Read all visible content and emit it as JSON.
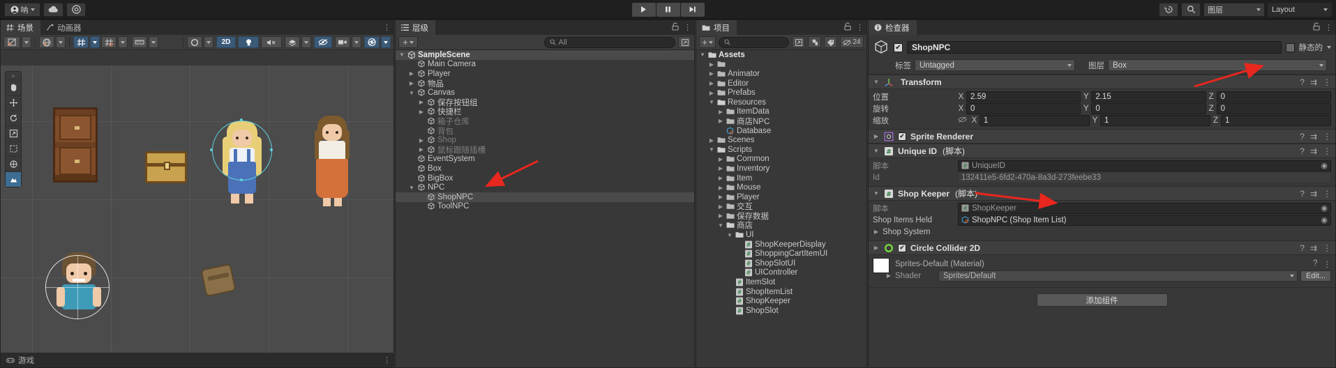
{
  "toolbar": {
    "account_label": "呐",
    "cloud_icon": "cloud-icon",
    "services_icon": "unity-services-icon",
    "play_icon": "play-icon",
    "pause_icon": "pause-icon",
    "step_icon": "step-icon",
    "undo_history_icon": "undo-history-icon",
    "search_icon": "search-icon",
    "layers_label": "图层",
    "layout_label": "Layout"
  },
  "scene": {
    "tabs": [
      {
        "label": "场景",
        "icon": "scene-grid-icon",
        "active": true
      },
      {
        "label": "动画器",
        "icon": "animator-icon",
        "active": false
      }
    ],
    "game_tab_label": "游戏",
    "toolbar": {
      "draw_mode_label": "shaded-draw-mode",
      "twod_label": "2D",
      "lighting_icon": "lighting-icon",
      "audio_icon": "audio-mute-icon",
      "fx_icon": "effects-icon",
      "hidden_icon": "hidden-objects-icon",
      "camera_icon": "scene-camera-icon",
      "gizmos_icon": "gizmos-icon"
    },
    "tools": [
      {
        "name": "hand-tool",
        "glyph": "✋",
        "selected": false
      },
      {
        "name": "move-tool",
        "glyph": "✥",
        "selected": false
      },
      {
        "name": "rotate-tool",
        "glyph": "⟳",
        "selected": false
      },
      {
        "name": "scale-tool",
        "glyph": "⤢",
        "selected": false
      },
      {
        "name": "rect-tool",
        "glyph": "⬚",
        "selected": false
      },
      {
        "name": "transform-tool",
        "glyph": "✧",
        "selected": false
      },
      {
        "name": "custom-tool",
        "glyph": "⌁",
        "selected": true
      }
    ]
  },
  "hierarchy": {
    "tab_label": "层级",
    "create_label": "+",
    "search_placeholder": "All",
    "items": [
      {
        "label": "SampleScene",
        "depth": 0,
        "arrow": "down",
        "icon": "unity-scene-icon",
        "root": true
      },
      {
        "label": "Main Camera",
        "depth": 1,
        "arrow": "none",
        "icon": "gameobject-icon"
      },
      {
        "label": "Player",
        "depth": 1,
        "arrow": "right",
        "icon": "gameobject-icon"
      },
      {
        "label": "物品",
        "depth": 1,
        "arrow": "right",
        "icon": "gameobject-icon"
      },
      {
        "label": "Canvas",
        "depth": 1,
        "arrow": "down",
        "icon": "gameobject-icon"
      },
      {
        "label": "保存按钮组",
        "depth": 2,
        "arrow": "right",
        "icon": "gameobject-icon"
      },
      {
        "label": "快捷栏",
        "depth": 2,
        "arrow": "right",
        "icon": "gameobject-icon"
      },
      {
        "label": "箱子仓库",
        "depth": 2,
        "arrow": "none",
        "icon": "gameobject-icon",
        "dim": true
      },
      {
        "label": "背包",
        "depth": 2,
        "arrow": "none",
        "icon": "gameobject-icon",
        "dim": true
      },
      {
        "label": "Shop",
        "depth": 2,
        "arrow": "right",
        "icon": "gameobject-icon",
        "dim": true
      },
      {
        "label": "鼠标跟随插槽",
        "depth": 2,
        "arrow": "right",
        "icon": "gameobject-icon",
        "dim": true
      },
      {
        "label": "EventSystem",
        "depth": 1,
        "arrow": "none",
        "icon": "gameobject-icon"
      },
      {
        "label": "Box",
        "depth": 1,
        "arrow": "none",
        "icon": "gameobject-icon"
      },
      {
        "label": "BigBox",
        "depth": 1,
        "arrow": "none",
        "icon": "gameobject-icon"
      },
      {
        "label": "NPC",
        "depth": 1,
        "arrow": "down",
        "icon": "gameobject-icon"
      },
      {
        "label": "ShopNPC",
        "depth": 2,
        "arrow": "none",
        "icon": "gameobject-icon",
        "selected": true
      },
      {
        "label": "ToolNPC",
        "depth": 2,
        "arrow": "none",
        "icon": "gameobject-icon"
      }
    ]
  },
  "project": {
    "tab_label": "项目",
    "create_label": "+",
    "search_placeholder": "",
    "hidden_count": "24",
    "items": [
      {
        "label": "Assets",
        "depth": 0,
        "arrow": "down",
        "icon": "folder-open-icon",
        "bold": true
      },
      {
        "label": "",
        "depth": 1,
        "arrow": "right",
        "icon": "folder-icon"
      },
      {
        "label": "Animator",
        "depth": 1,
        "arrow": "right",
        "icon": "folder-icon"
      },
      {
        "label": "Editor",
        "depth": 1,
        "arrow": "right",
        "icon": "folder-icon"
      },
      {
        "label": "Prefabs",
        "depth": 1,
        "arrow": "right",
        "icon": "folder-icon"
      },
      {
        "label": "Resources",
        "depth": 1,
        "arrow": "down",
        "icon": "folder-open-icon"
      },
      {
        "label": "ItemData",
        "depth": 2,
        "arrow": "right",
        "icon": "folder-icon"
      },
      {
        "label": "商店NPC",
        "depth": 2,
        "arrow": "right",
        "icon": "folder-icon"
      },
      {
        "label": "Database",
        "depth": 2,
        "arrow": "none",
        "icon": "prefab-icon"
      },
      {
        "label": "Scenes",
        "depth": 1,
        "arrow": "right",
        "icon": "folder-icon"
      },
      {
        "label": "Scripts",
        "depth": 1,
        "arrow": "down",
        "icon": "folder-open-icon"
      },
      {
        "label": "Common",
        "depth": 2,
        "arrow": "right",
        "icon": "folder-icon"
      },
      {
        "label": "Inventory",
        "depth": 2,
        "arrow": "right",
        "icon": "folder-icon"
      },
      {
        "label": "Item",
        "depth": 2,
        "arrow": "right",
        "icon": "folder-icon"
      },
      {
        "label": "Mouse",
        "depth": 2,
        "arrow": "right",
        "icon": "folder-icon"
      },
      {
        "label": "Player",
        "depth": 2,
        "arrow": "right",
        "icon": "folder-icon"
      },
      {
        "label": "交互",
        "depth": 2,
        "arrow": "right",
        "icon": "folder-icon"
      },
      {
        "label": "保存数据",
        "depth": 2,
        "arrow": "right",
        "icon": "folder-icon"
      },
      {
        "label": "商店",
        "depth": 2,
        "arrow": "down",
        "icon": "folder-open-icon"
      },
      {
        "label": "UI",
        "depth": 3,
        "arrow": "down",
        "icon": "folder-open-icon"
      },
      {
        "label": "ShopKeeperDisplay",
        "depth": 4,
        "arrow": "none",
        "icon": "csharp-script-icon"
      },
      {
        "label": "ShoppingCartItemUI",
        "depth": 4,
        "arrow": "none",
        "icon": "csharp-script-icon"
      },
      {
        "label": "ShopSlotUI",
        "depth": 4,
        "arrow": "none",
        "icon": "csharp-script-icon"
      },
      {
        "label": "UIController",
        "depth": 4,
        "arrow": "none",
        "icon": "csharp-script-icon"
      },
      {
        "label": "ItemSlot",
        "depth": 3,
        "arrow": "none",
        "icon": "csharp-script-icon"
      },
      {
        "label": "ShopItemList",
        "depth": 3,
        "arrow": "none",
        "icon": "csharp-script-icon"
      },
      {
        "label": "ShopKeeper",
        "depth": 3,
        "arrow": "none",
        "icon": "csharp-script-icon"
      },
      {
        "label": "ShopSlot",
        "depth": 3,
        "arrow": "none",
        "icon": "csharp-script-icon"
      }
    ]
  },
  "inspector": {
    "tab_label": "检查器",
    "object_name": "ShopNPC",
    "static_label": "静态的",
    "tag_label": "标签",
    "tag_value": "Untagged",
    "layer_label": "图层",
    "layer_value": "Box",
    "transform": {
      "title": "Transform",
      "position_label": "位置",
      "rotation_label": "旋转",
      "scale_label": "缩放",
      "axis_x": "X",
      "axis_y": "Y",
      "axis_z": "Z",
      "position": {
        "x": "2.59",
        "y": "2.15",
        "z": "0"
      },
      "rotation": {
        "x": "0",
        "y": "0",
        "z": "0"
      },
      "scale": {
        "x": "1",
        "y": "1",
        "z": "1"
      }
    },
    "sprite_renderer": {
      "title": "Sprite Renderer"
    },
    "unique_id": {
      "title": "Unique ID",
      "script_suffix": "(脚本)",
      "script_label": "脚本",
      "script_value": "UniqueID",
      "id_label": "Id",
      "id_value": "132411e5-6fd2-470a-8a3d-273feebe33"
    },
    "shop_keeper": {
      "title": "Shop Keeper",
      "script_suffix": "(脚本)",
      "script_label": "脚本",
      "script_value": "ShopKeeper",
      "items_held_label": "Shop Items Held",
      "items_held_value": "ShopNPC (Shop Item List)",
      "shop_system_label": "Shop System"
    },
    "circle_collider": {
      "title": "Circle Collider 2D"
    },
    "material": {
      "name": "Sprites-Default (Material)",
      "shader_label": "Shader",
      "shader_value": "Sprites/Default",
      "edit_label": "Edit..."
    },
    "add_component_label": "添加组件"
  },
  "colors": {
    "panel_bg": "#383838",
    "toolbar_bg": "#1f1f1f",
    "selected_row": "#4a4a4a",
    "accent_blue": "#3b5a78",
    "annotation_red": "#e8271e",
    "selection_cyan": "#5fd0e0",
    "collider_green": "#7cf03c"
  }
}
